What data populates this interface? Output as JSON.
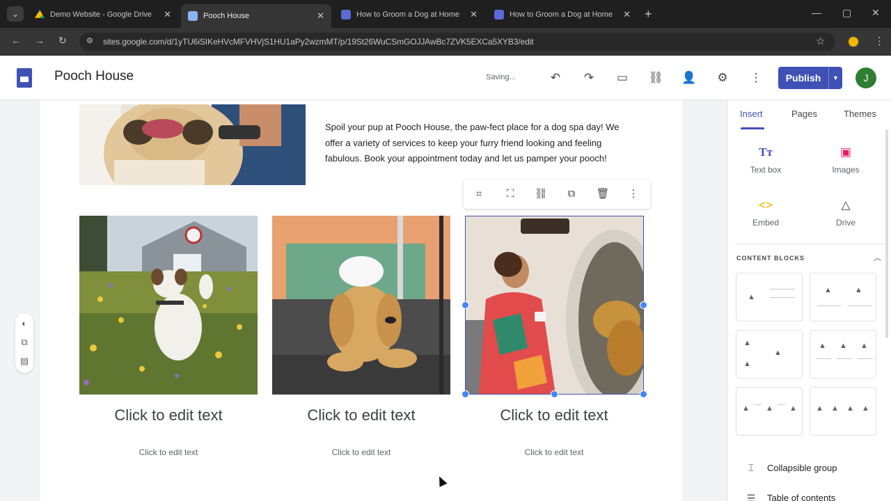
{
  "browser": {
    "tabs": [
      {
        "title": "Demo Website - Google Drive",
        "active": false
      },
      {
        "title": "Pooch House",
        "active": true
      },
      {
        "title": "How to Groom a Dog at Home",
        "active": false
      },
      {
        "title": "How to Groom a Dog at Home",
        "active": false
      }
    ],
    "url": "sites.google.com/d/1yTU6iSIKeHVcMFVHVjS1HU1aPy2wzmMT/p/19St26WuCSmGOJJAwBc7ZVK5EXCa5XYB3/edit"
  },
  "header": {
    "site_title": "Pooch House",
    "status": "Saving...",
    "publish_label": "Publish",
    "avatar_letter": "J"
  },
  "content": {
    "intro": "Spoil your pup at Pooch House, the paw-fect place for a dog spa day! We offer a variety of services to keep your furry friend looking and feeling fabulous.  Book your appointment today and let us pamper your pooch!",
    "cards": [
      {
        "title": "Click to edit text",
        "subtitle": "Click to edit text"
      },
      {
        "title": "Click to edit text",
        "subtitle": "Click to edit text"
      },
      {
        "title": "Click to edit text",
        "subtitle": "Click to edit text"
      }
    ]
  },
  "panel": {
    "tabs": [
      "Insert",
      "Pages",
      "Themes"
    ],
    "tools": [
      {
        "label": "Text box",
        "icon": "text-box-icon"
      },
      {
        "label": "Images",
        "icon": "images-icon"
      },
      {
        "label": "Embed",
        "icon": "embed-icon"
      },
      {
        "label": "Drive",
        "icon": "drive-icon"
      }
    ],
    "content_blocks_title": "CONTENT BLOCKS",
    "list_items": [
      "Collapsible group",
      "Table of contents"
    ]
  },
  "colors": {
    "accent": "#3f51b5",
    "handle": "#4285f4",
    "chrome_bg": "#1f1f1f"
  }
}
